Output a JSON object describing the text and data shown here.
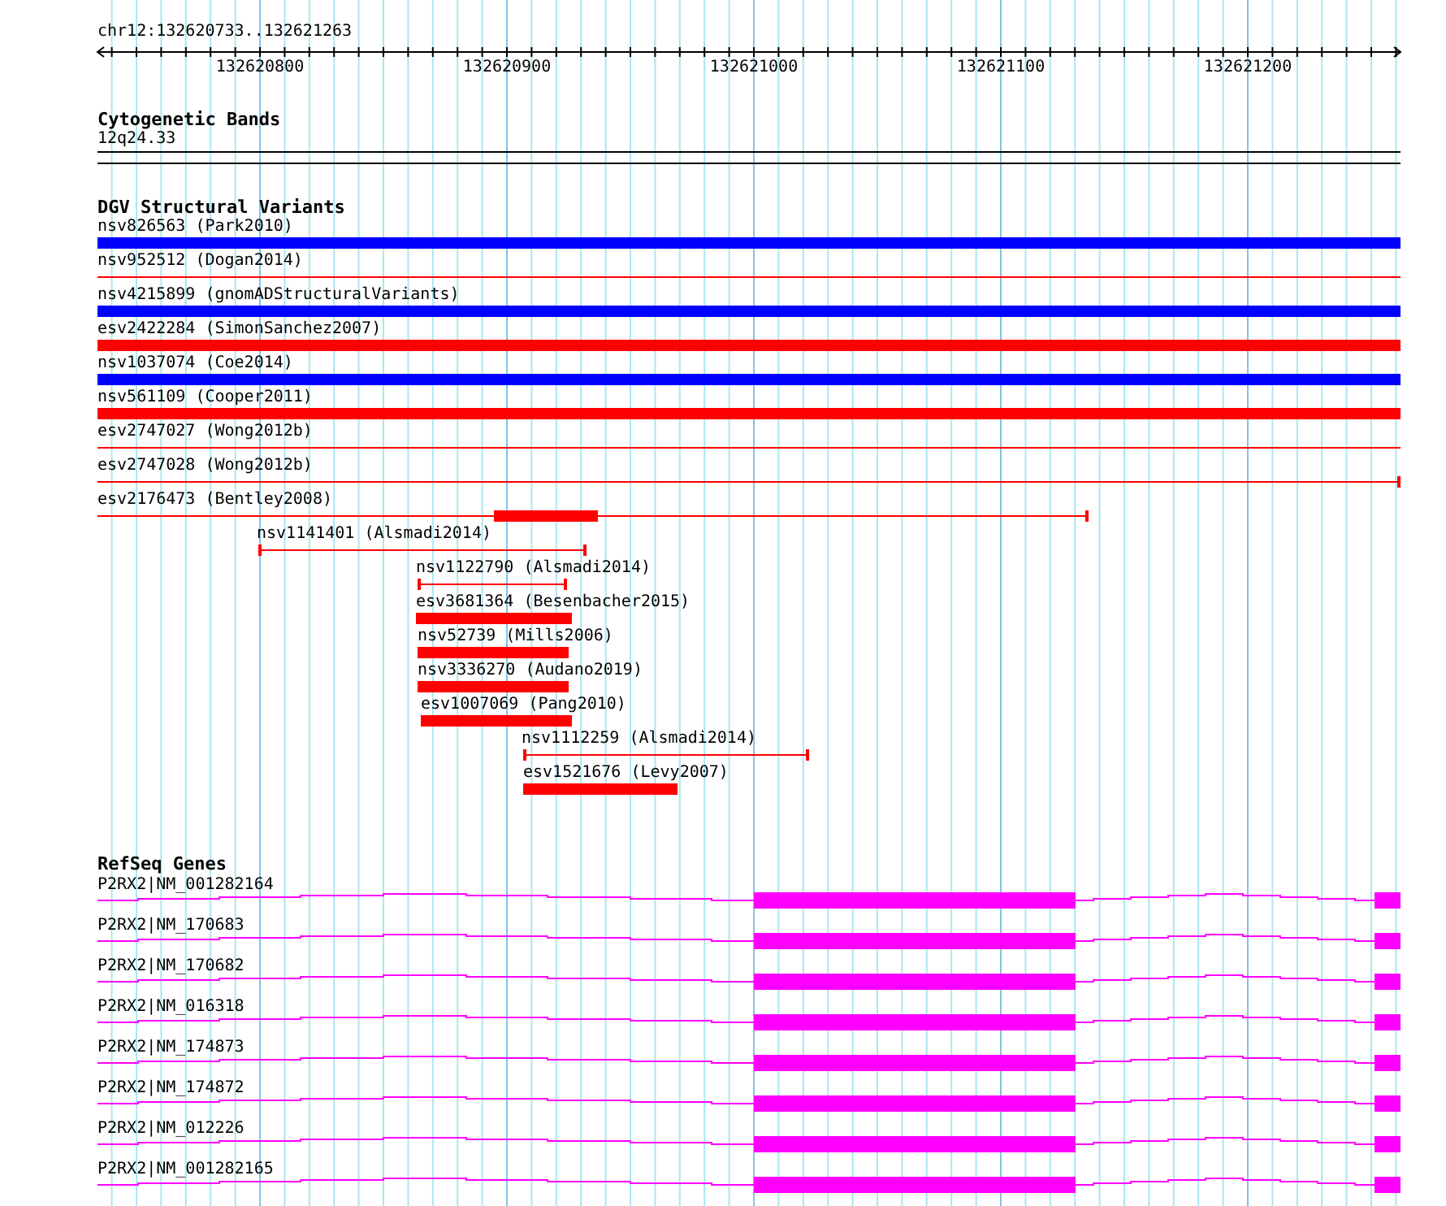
{
  "ruler": {
    "location": "chr12:132620733..132621263",
    "ticks": [
      "132620800",
      "132620900",
      "132621000",
      "132621100",
      "132621200"
    ]
  },
  "tracks": [
    {
      "kind": "cytoband",
      "title": "Cytogenetic Bands",
      "features": [
        {
          "label": "12q24.33"
        }
      ]
    },
    {
      "kind": "variants",
      "title": "DGV Structural Variants",
      "features": [
        {
          "label": "nsv826563 (Park2010)",
          "kind": "block",
          "color": "#0000ff"
        },
        {
          "label": "nsv952512 (Dogan2014)",
          "kind": "line",
          "color": "#ff0000"
        },
        {
          "label": "nsv4215899 (gnomADStructuralVariants)",
          "kind": "block",
          "color": "#0000ff"
        },
        {
          "label": "esv2422284 (SimonSanchez2007)",
          "kind": "block",
          "color": "#ff0000"
        },
        {
          "label": "nsv1037074 (Coe2014)",
          "kind": "block",
          "color": "#0000ff"
        },
        {
          "label": "nsv561109 (Cooper2011)",
          "kind": "block",
          "color": "#ff0000"
        },
        {
          "label": "esv2747027 (Wong2012b)",
          "kind": "line",
          "color": "#ff0000"
        },
        {
          "label": "esv2747028 (Wong2012b)",
          "kind": "line",
          "color": "#ff0000"
        },
        {
          "label": "esv2176473 (Bentley2008)",
          "kind": "partial",
          "color": "#ff0000"
        },
        {
          "label": "nsv1141401 (Alsmadi2014)",
          "kind": "line",
          "color": "#ff0000"
        },
        {
          "label": "nsv1122790 (Alsmadi2014)",
          "kind": "line",
          "color": "#ff0000"
        },
        {
          "label": "esv3681364 (Besenbacher2015)",
          "kind": "block",
          "color": "#ff0000"
        },
        {
          "label": "nsv52739 (Mills2006)",
          "kind": "block",
          "color": "#ff0000"
        },
        {
          "label": "nsv3336270 (Audano2019)",
          "kind": "block",
          "color": "#ff0000"
        },
        {
          "label": "esv1007069 (Pang2010)",
          "kind": "block",
          "color": "#ff0000"
        },
        {
          "label": "nsv1112259 (Alsmadi2014)",
          "kind": "line",
          "color": "#ff0000"
        },
        {
          "label": "esv1521676 (Levy2007)",
          "kind": "block",
          "color": "#ff0000"
        }
      ]
    },
    {
      "kind": "genes",
      "title": "RefSeq Genes",
      "features": [
        {
          "label": "P2RX2|NM_001282164"
        },
        {
          "label": "P2RX2|NM_170683"
        },
        {
          "label": "P2RX2|NM_170682"
        },
        {
          "label": "P2RX2|NM_016318"
        },
        {
          "label": "P2RX2|NM_174873"
        },
        {
          "label": "P2RX2|NM_174872"
        },
        {
          "label": "P2RX2|NM_012226"
        },
        {
          "label": "P2RX2|NM_001282165"
        }
      ]
    }
  ]
}
